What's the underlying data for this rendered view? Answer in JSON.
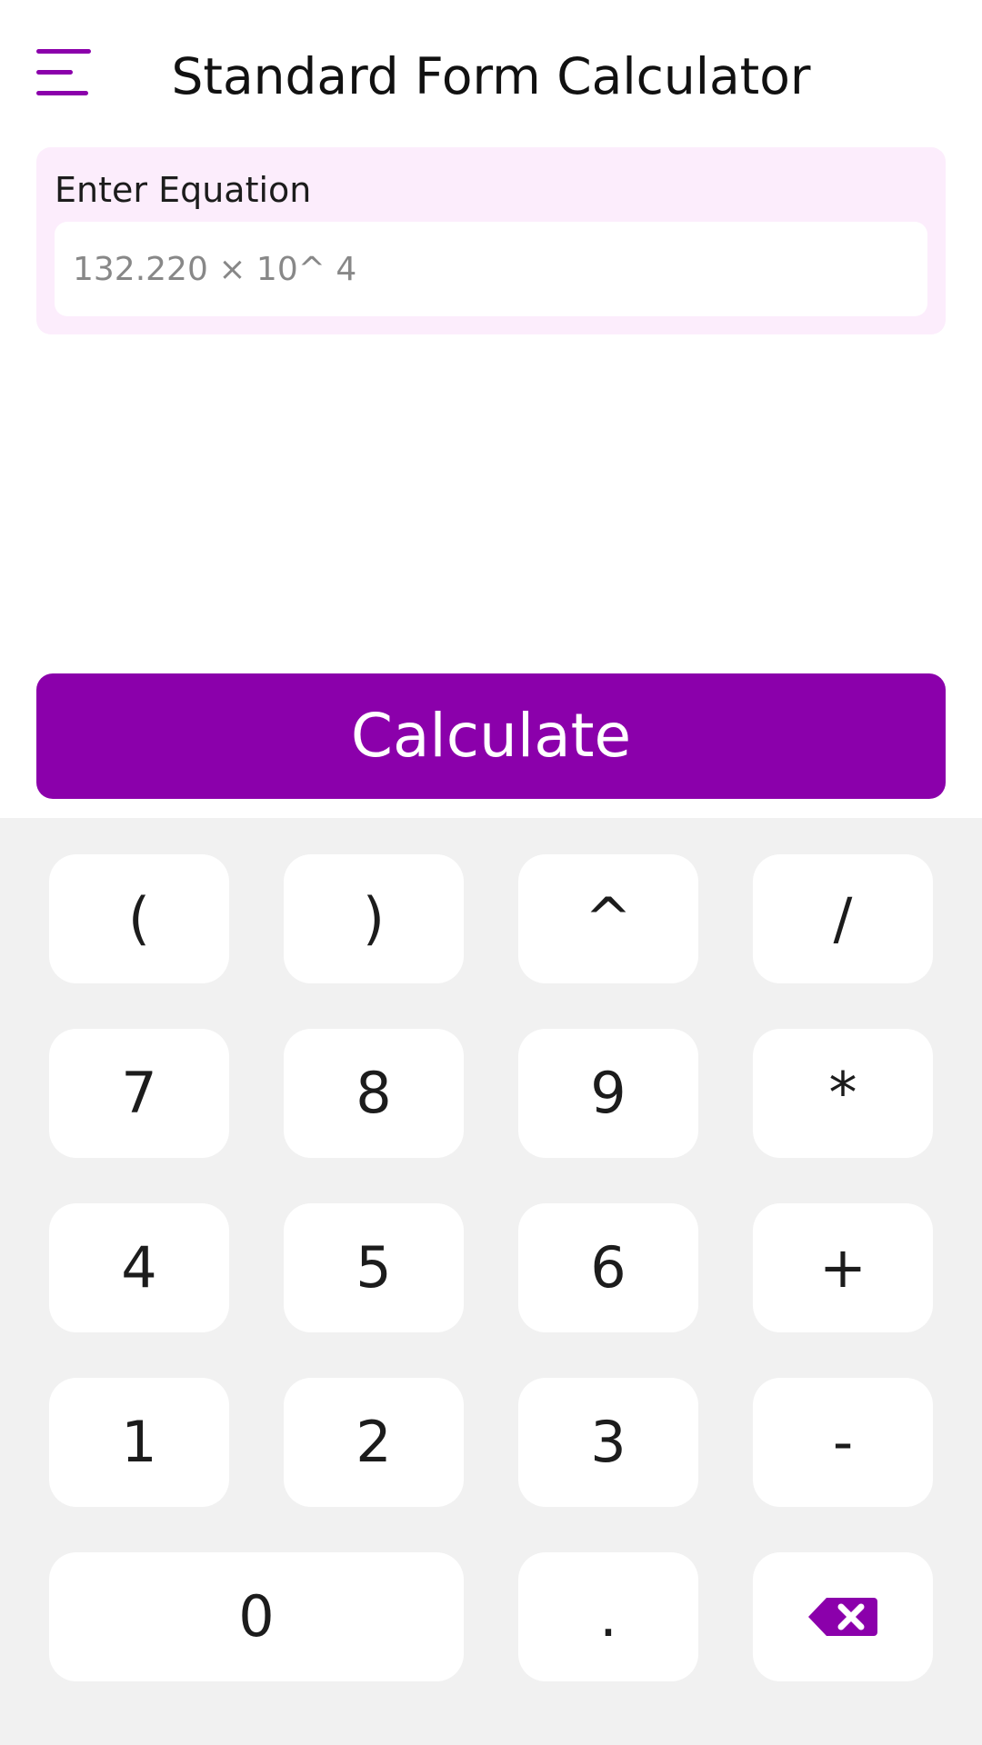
{
  "header": {
    "title": "Standard Form Calculator",
    "menu_icon": "hamburger-menu-icon"
  },
  "equation": {
    "label": "Enter Equation",
    "value": "",
    "placeholder": "132.220 × 10^ 4"
  },
  "calculate": {
    "label": "Calculate"
  },
  "keypad": {
    "open_paren": "(",
    "close_paren": ")",
    "caret": "^",
    "divide": "/",
    "seven": "7",
    "eight": "8",
    "nine": "9",
    "multiply": "*",
    "four": "4",
    "five": "5",
    "six": "6",
    "plus": "+",
    "one": "1",
    "two": "2",
    "three": "3",
    "minus": "-",
    "zero": "0",
    "decimal": ".",
    "backspace_icon": "backspace-icon"
  },
  "colors": {
    "accent": "#8b00ab",
    "card_background": "#fcedfc",
    "keypad_background": "#f1f1f1"
  }
}
